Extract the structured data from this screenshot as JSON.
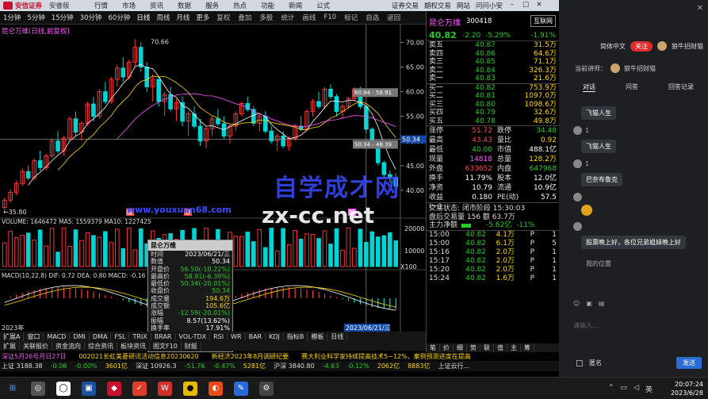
{
  "topbar": {
    "brand": "安信证券",
    "edition": "安睿版",
    "menu": [
      "行情",
      "市场",
      "资讯",
      "数据",
      "服务",
      "热点",
      "功能",
      "新闻",
      "公式"
    ],
    "right_tabs": [
      "证券交易",
      "期权交易",
      "网站",
      "问问小安"
    ],
    "win": [
      "–",
      "□",
      "✕"
    ]
  },
  "toolbar": {
    "periods": [
      "1分钟",
      "5分钟",
      "15分钟",
      "30分钟",
      "60分钟",
      "日线",
      "周线",
      "月线",
      "更多"
    ],
    "tools": [
      "复权",
      "叠加",
      "多股",
      "统计",
      "画线",
      "F10",
      "标记",
      "自选",
      "返回"
    ]
  },
  "chart": {
    "title": "昆仑万维(日线,前复权)",
    "high_label": "70.66",
    "low_label": "35.80",
    "price_axis": [
      "70.00",
      "65.00",
      "60.00",
      "55.00",
      "50.00",
      "45.00",
      "40.00"
    ],
    "cursor_tag": "50.34",
    "range_tag1": "60.94 - 58.91",
    "range_tag2": "50.34 - 48.39",
    "vol_line": "VOLUME: 1646472  MA5: 1559379  MA10: 1227425",
    "vol_axis": [
      "20000",
      "10000"
    ],
    "vol_unit": "X100",
    "macd_line": "MACD(10,22,8)  DIF: 0.72  DEA: 0.80  MACD: -0.16",
    "date_left": "2023年",
    "date_cursor": "2023/06/21/三",
    "markers": [
      "陇",
      "进",
      "颜"
    ]
  },
  "chart_data": {
    "type": "candlestick",
    "title": "昆仑万维(日线,前复权)",
    "ylim": [
      35,
      72
    ],
    "annotations": [
      {
        "text": "70.66",
        "kind": "high"
      },
      {
        "text": "35.80",
        "kind": "low"
      }
    ],
    "candles": [
      [
        36.5,
        38.5,
        35.8,
        38.0
      ],
      [
        38.0,
        40.2,
        37.5,
        39.6
      ],
      [
        39.6,
        42.0,
        39.0,
        41.4
      ],
      [
        41.4,
        44.5,
        40.8,
        43.8
      ],
      [
        43.8,
        45.0,
        42.0,
        42.5
      ],
      [
        42.5,
        46.5,
        42.0,
        46.0
      ],
      [
        46.0,
        48.0,
        44.0,
        44.6
      ],
      [
        44.6,
        47.5,
        44.0,
        47.0
      ],
      [
        47.0,
        50.5,
        46.5,
        50.0
      ],
      [
        50.0,
        52.0,
        47.5,
        48.0
      ],
      [
        48.0,
        51.0,
        47.0,
        50.6
      ],
      [
        50.6,
        55.0,
        50.0,
        54.5
      ],
      [
        54.5,
        56.0,
        51.0,
        51.8
      ],
      [
        51.8,
        54.0,
        50.0,
        53.6
      ],
      [
        53.6,
        58.0,
        53.0,
        57.5
      ],
      [
        57.5,
        59.0,
        54.0,
        55.0
      ],
      [
        55.0,
        60.5,
        54.5,
        60.0
      ],
      [
        60.0,
        62.0,
        57.5,
        58.0
      ],
      [
        58.0,
        63.0,
        57.5,
        62.5
      ],
      [
        62.5,
        65.5,
        61.0,
        64.8
      ],
      [
        64.8,
        67.0,
        62.0,
        63.0
      ],
      [
        63.0,
        66.5,
        62.5,
        66.0
      ],
      [
        66.0,
        70.66,
        65.0,
        69.0
      ],
      [
        69.0,
        70.0,
        64.0,
        65.0
      ],
      [
        65.0,
        66.0,
        60.0,
        61.0
      ],
      [
        61.0,
        63.5,
        58.0,
        62.5
      ],
      [
        62.5,
        63.0,
        57.0,
        58.0
      ],
      [
        58.0,
        60.0,
        55.0,
        59.4
      ],
      [
        59.4,
        61.0,
        56.0,
        56.5
      ],
      [
        56.5,
        58.5,
        54.0,
        57.8
      ],
      [
        57.8,
        59.0,
        53.0,
        54.0
      ],
      [
        54.0,
        56.0,
        51.0,
        55.5
      ],
      [
        55.5,
        57.0,
        52.5,
        53.0
      ],
      [
        53.0,
        54.5,
        49.0,
        50.0
      ],
      [
        50.0,
        53.0,
        48.5,
        52.5
      ],
      [
        52.5,
        55.0,
        51.0,
        54.5
      ],
      [
        54.5,
        56.5,
        53.0,
        53.5
      ],
      [
        53.5,
        55.0,
        50.5,
        51.0
      ],
      [
        51.0,
        53.5,
        49.5,
        53.0
      ],
      [
        53.0,
        56.0,
        52.0,
        55.5
      ],
      [
        55.5,
        58.0,
        55.0,
        57.6
      ],
      [
        57.6,
        59.0,
        56.0,
        56.4
      ],
      [
        56.4,
        57.0,
        53.0,
        53.6
      ],
      [
        53.6,
        55.5,
        52.0,
        55.0
      ],
      [
        55.0,
        56.0,
        51.5,
        52.0
      ],
      [
        52.0,
        53.0,
        49.5,
        50.0
      ],
      [
        50.0,
        51.5,
        48.0,
        51.0
      ],
      [
        51.0,
        52.0,
        48.5,
        49.0
      ],
      [
        49.0,
        51.0,
        48.0,
        50.5
      ],
      [
        50.5,
        53.5,
        50.0,
        53.0
      ],
      [
        53.0,
        55.0,
        52.0,
        52.4
      ],
      [
        52.4,
        56.5,
        52.0,
        56.0
      ],
      [
        56.0,
        58.5,
        55.0,
        58.0
      ],
      [
        58.0,
        60.0,
        56.5,
        57.0
      ],
      [
        57.0,
        61.0,
        56.5,
        60.5
      ],
      [
        60.5,
        61.5,
        58.5,
        59.0
      ],
      [
        59.0,
        59.5,
        55.0,
        56.0
      ],
      [
        56.0,
        57.5,
        54.5,
        57.0
      ],
      [
        57.0,
        59.0,
        56.5,
        58.6
      ],
      [
        58.6,
        60.9,
        58.0,
        60.5
      ],
      [
        60.5,
        61.0,
        56.5,
        57.0
      ],
      [
        57.0,
        57.5,
        51.7,
        52.4
      ],
      [
        52.4,
        52.8,
        48.5,
        49.0
      ],
      [
        49.0,
        49.5,
        45.0,
        45.6
      ],
      [
        45.6,
        46.0,
        42.5,
        43.2
      ],
      [
        43.2,
        44.0,
        41.5,
        42.6
      ],
      [
        42.6,
        43.4,
        40.0,
        40.8
      ]
    ]
  },
  "quote": {
    "name": "昆仑万维",
    "code": "300418",
    "badge": "互联网",
    "price": "40.82",
    "change": "-2.20",
    "pct": "-5.29%",
    "pct2": "-1.91%",
    "asks": [
      {
        "label": "卖五",
        "price": "40.87",
        "qty": "31.5万"
      },
      {
        "label": "卖四",
        "price": "40.86",
        "qty": "64.6万"
      },
      {
        "label": "卖三",
        "price": "40.85",
        "qty": "71.1万"
      },
      {
        "label": "卖二",
        "price": "40.84",
        "qty": "326.3万"
      },
      {
        "label": "卖一",
        "price": "40.83",
        "qty": "21.6万"
      }
    ],
    "bids": [
      {
        "label": "买一",
        "price": "40.82",
        "qty": "753.9万"
      },
      {
        "label": "买二",
        "price": "40.81",
        "qty": "1097.0万"
      },
      {
        "label": "买三",
        "price": "40.80",
        "qty": "1098.6万"
      },
      {
        "label": "买四",
        "price": "40.79",
        "qty": "32.6万"
      },
      {
        "label": "买五",
        "price": "40.78",
        "qty": "49.8万"
      }
    ],
    "stats": [
      {
        "k": "涨停",
        "v": "51.72",
        "vc": "c-red",
        "k2": "跌停",
        "v2": "34.48",
        "v2c": "c-grn"
      },
      {
        "k": "最高",
        "v": "43.43",
        "vc": "c-red",
        "k2": "量比",
        "v2": "0.92",
        "v2c": "c-yel"
      },
      {
        "k": "最低",
        "v": "40.00",
        "vc": "c-grn",
        "k2": "市值",
        "v2": "488.1亿",
        "v2c": "c-wht"
      },
      {
        "k": "现量",
        "v": "14818",
        "vc": "c-mag",
        "k2": "总量",
        "v2": "128.2万",
        "v2c": "c-yel"
      },
      {
        "k": "外盘",
        "v": "633652",
        "vc": "c-red",
        "k2": "内盘",
        "v2": "647968",
        "v2c": "c-grn"
      },
      {
        "k": "换手",
        "v": "11.79%",
        "vc": "c-wht",
        "k2": "股本",
        "v2": "12.0亿",
        "v2c": "c-wht"
      },
      {
        "k": "净资",
        "v": "10.79",
        "vc": "c-wht",
        "k2": "流通",
        "v2": "10.9亿",
        "v2c": "c-wht"
      },
      {
        "k": "收益(一)",
        "v": "0.180",
        "vc": "c-wht",
        "k2": "PE(动)",
        "v2": "57.5",
        "v2c": "c-wht"
      }
    ],
    "trade_state": "交易状态: 闭市阶段 15:30:03",
    "after_hours": "盘后交易量 156  额 63.7万",
    "flow_label": "主力净额",
    "flow_val": "-5.62亿",
    "flow_pct": "-11%",
    "ticks": [
      {
        "t": "15:00",
        "p": "40.82",
        "q": "4.1万",
        "n": "P",
        "one": "1"
      },
      {
        "t": "15:00",
        "p": "40.82",
        "q": "6.1万",
        "n": "P",
        "one": "5"
      },
      {
        "t": "15:16",
        "p": "40.82",
        "q": "2.0万",
        "n": "P",
        "one": "1"
      },
      {
        "t": "15:17",
        "p": "40.82",
        "q": "2.0万",
        "n": "P",
        "one": "1"
      },
      {
        "t": "15:20",
        "p": "40.82",
        "q": "2.0万",
        "n": "P",
        "one": "1"
      },
      {
        "t": "15:24",
        "p": "40.82",
        "q": "1.6万",
        "n": "P",
        "one": "1"
      }
    ],
    "tabs": [
      "笔",
      "价",
      "细",
      "势",
      "联",
      "值",
      "主",
      "筹"
    ]
  },
  "tooltip": {
    "title": "昆仑万维",
    "rows": [
      {
        "k": "时间",
        "v": "2023/06/21/三",
        "c": "c-wht"
      },
      {
        "k": "数值",
        "v": "50.34",
        "c": "c-wht"
      },
      {
        "k": "开盘价",
        "v": "56.50(-10.22%)",
        "c": "c-grn"
      },
      {
        "k": "最高价",
        "v": "58.91(-6.39%)",
        "c": "c-grn"
      },
      {
        "k": "最低价",
        "v": "50.34(-20.01%)",
        "c": "c-grn"
      },
      {
        "k": "收盘价",
        "v": "50.34",
        "c": "c-grn"
      },
      {
        "k": "成交量",
        "v": "194.6万",
        "c": "c-yel"
      },
      {
        "k": "成交额",
        "v": "105.6亿",
        "c": "c-yel"
      },
      {
        "k": "涨幅",
        "v": "-12.59(-20.01%)",
        "c": "c-grn"
      },
      {
        "k": "振幅",
        "v": "8.57(13.62%)",
        "c": "c-wht"
      },
      {
        "k": "换手率",
        "v": "17.91%",
        "c": "c-wht"
      },
      {
        "k": "流通股",
        "v": "10.9亿",
        "c": "c-wht"
      }
    ]
  },
  "bottom_tabs": [
    "扩展A",
    "窗口",
    "MACD",
    "DMI",
    "DMA",
    "FSL",
    "TRIX",
    "BRAR",
    "VOL-TDX",
    "RSI",
    "WR",
    "BAR",
    "KDJ",
    "指标B",
    "模板",
    "日线"
  ],
  "bottom_tabs2": [
    "扩展",
    "关联报价",
    "资金流向",
    "综合资讯",
    "板块资讯",
    "图文F10",
    "财报"
  ],
  "ticker": [
    "深证5月26号月日27日",
    "002021长虹美菱研讯活动信息20230620",
    "新经济2023年8月调研纪要",
    "赛大利业科学家持续提高技术5~12%，案例预测进度在提高"
  ],
  "indexbar": [
    "上证 3188.38",
    "-0.06",
    "-0.00%",
    "3601亿",
    "深证 10926.3",
    "-51.76",
    "-0.47%",
    "5281亿",
    "沪深 3840.80",
    "-4.63",
    "-0.12%",
    "2062亿",
    "8883亿",
    "上证云行..."
  ],
  "watermark": {
    "cn": "自学成才网",
    "url": "zx-cc.net",
    "small": "www.youxuan68.com"
  },
  "chat": {
    "lang": "简体中文",
    "follow": "关注",
    "host": "狼牛招财猫",
    "current": "当前讲师：",
    "current_name": "狼牛招财猫",
    "tabs": [
      "对话",
      "问答",
      "回答记录"
    ],
    "messages": [
      {
        "text": "飞猫人生",
        "count": "1"
      },
      {
        "text": "飞猫人生",
        "count": "1"
      },
      {
        "text": "巴奈布鲁克",
        "count": ""
      },
      {
        "text": "",
        "count": "",
        "emoji": true
      }
    ],
    "long_msg": "股票晚上好，各位兄弟姐妹晚上好",
    "input_ph": "请输入...",
    "anon": "匿名",
    "send": "发送",
    "my_pos": "我的位置"
  },
  "taskbar": {
    "time": "20:07:24",
    "date": "2023/6/28",
    "ime": "英"
  }
}
